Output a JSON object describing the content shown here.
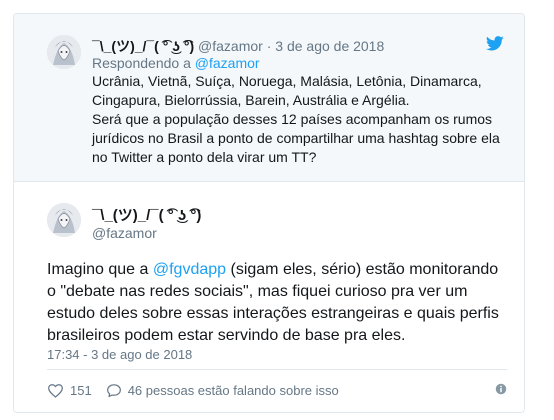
{
  "parent_tweet": {
    "display_name": "¯\\_(ツ)_/¯( ͡° ͜ʖ ͡°)",
    "handle": "@fazamor",
    "separator": "·",
    "date": "3 de ago de 2018",
    "reply_prefix": "Respondendo a",
    "reply_handle": "@fazamor",
    "text_lines": [
      "Ucrânia, Vietnã, Suíça, Noruega, Malásia, Letônia, Dinamarca,",
      "Cingapura, Bielorrússia, Barein, Austrália e Argélia.",
      "Será que a população desses 12 países acompanham os rumos",
      "jurídicos no Brasil a ponto de compartilhar uma hashtag sobre ela",
      "no Twitter a ponto dela virar um TT?"
    ]
  },
  "main_tweet": {
    "display_name": "¯\\_(ツ)_/¯( ͡° ͜ʖ ͡°)",
    "handle": "@fazamor",
    "text_before_link": "Imagino que a ",
    "link": "@fgvdapp",
    "text_after_link_line1": " (sigam eles, sério) estão monitorando",
    "text_lines_rest": [
      "o \"debate nas redes sociais\", mas fiquei curioso pra ver um",
      "estudo deles sobre essas interações estrangeiras e quais perfis",
      "brasileiros podem estar servindo de base pra eles."
    ],
    "timestamp": "17:34 - 3 de ago de 2018",
    "like_count": "151",
    "conversation_text": "46 pessoas estão falando sobre isso"
  },
  "icons": {
    "brand": "twitter-bird-icon",
    "like": "heart-icon",
    "reply": "speech-bubble-icon",
    "info": "info-icon"
  },
  "colors": {
    "link": "#1da1f2",
    "muted": "#657786",
    "parent_bg": "#f5f8fa",
    "border": "#e1e8ed"
  }
}
